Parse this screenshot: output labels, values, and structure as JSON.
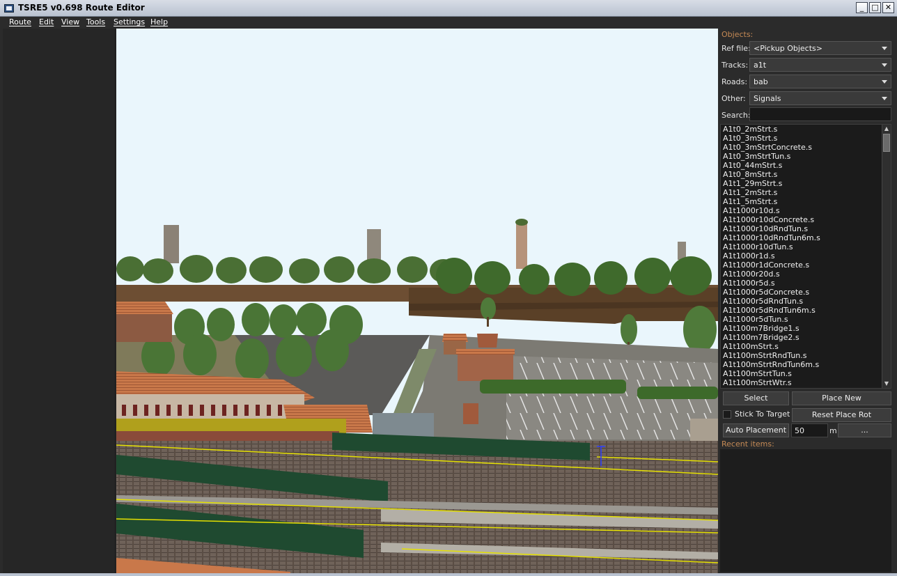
{
  "window": {
    "title": "TSRE5 v0.698 Route Editor",
    "min": "_",
    "max": "□",
    "close": "✕"
  },
  "menu": [
    "Route",
    "Edit",
    "View",
    "Tools",
    "Settings",
    "Help"
  ],
  "panel": {
    "objects_label": "Objects:",
    "ref_file_label": "Ref file:",
    "ref_file_value": "<Pickup Objects>",
    "tracks_label": "Tracks:",
    "tracks_value": "a1t",
    "roads_label": "Roads:",
    "roads_value": "bab",
    "other_label": "Other:",
    "other_value": "Signals",
    "search_label": "Search:",
    "search_value": "",
    "items": [
      "A1t0_2mStrt.s",
      "A1t0_3mStrt.s",
      "A1t0_3mStrtConcrete.s",
      "A1t0_3mStrtTun.s",
      "A1t0_44mStrt.s",
      "A1t0_8mStrt.s",
      "A1t1_29mStrt.s",
      "A1t1_2mStrt.s",
      "A1t1_5mStrt.s",
      "A1t1000r10d.s",
      "A1t1000r10dConcrete.s",
      "A1t1000r10dRndTun.s",
      "A1t1000r10dRndTun6m.s",
      "A1t1000r10dTun.s",
      "A1t1000r1d.s",
      "A1t1000r1dConcrete.s",
      "A1t1000r20d.s",
      "A1t1000r5d.s",
      "A1t1000r5dConcrete.s",
      "A1t1000r5dRndTun.s",
      "A1t1000r5dRndTun6m.s",
      "A1t1000r5dTun.s",
      "A1t100m7Bridge1.s",
      "A1t100m7Bridge2.s",
      "A1t100mStrt.s",
      "A1t100mStrtRndTun.s",
      "A1t100mStrtRndTun6m.s",
      "A1t100mStrtTun.s",
      "A1t100mStrtWtr.s"
    ],
    "select_btn": "Select",
    "place_new_btn": "Place New",
    "stick_label": "Stick To Target",
    "reset_rot_btn": "Reset Place Rot",
    "auto_place_btn": "Auto Placement",
    "distance_value": "50",
    "distance_unit": "m",
    "more_btn": "...",
    "recent_label": "Recent items:"
  },
  "colors": {
    "accent_label": "#c58a55",
    "sky": "#eaf6fc",
    "panel_bg": "#2b2b2b"
  }
}
